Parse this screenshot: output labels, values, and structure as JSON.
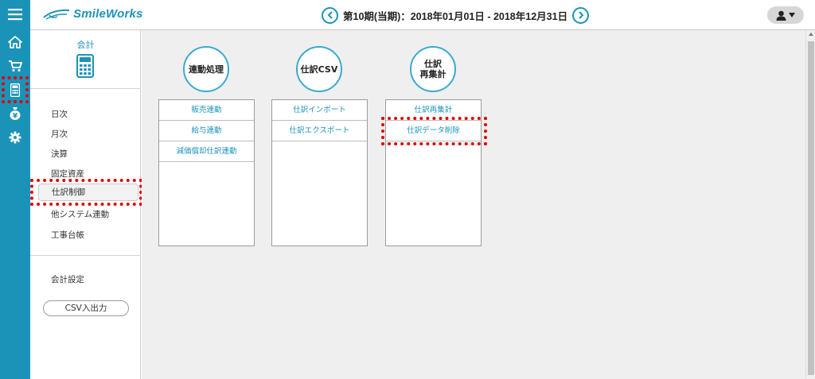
{
  "app": {
    "logo_text": "SmileWorks"
  },
  "header": {
    "period_text": "第10期(当期)：2018年01月01日 - 2018年12月31日",
    "prev_icon": "chevron-left-icon",
    "next_icon": "chevron-right-icon",
    "user_icon": "user-icon"
  },
  "rail": {
    "items": [
      {
        "icon": "hamburger-menu-icon"
      },
      {
        "icon": "home-icon"
      },
      {
        "icon": "cart-icon"
      },
      {
        "icon": "calculator-icon",
        "selected": true
      },
      {
        "icon": "yen-bag-icon"
      },
      {
        "icon": "gear-icon"
      }
    ]
  },
  "nav": {
    "title": "会計",
    "items": [
      "日次",
      "月次",
      "決算",
      "固定資産",
      "仕訳制御",
      "他システム連動",
      "工事台帳"
    ],
    "active_index": 4,
    "settings_label": "会計設定",
    "csv_button_label": "CSV入出力"
  },
  "columns": [
    {
      "title_line1": "連動処理",
      "title_line2": "",
      "items": [
        "販売連動",
        "給与連動",
        "減価償却仕訳連動"
      ]
    },
    {
      "title_line1": "仕訳CSV",
      "title_line2": "",
      "items": [
        "仕訳インポート",
        "仕訳エクスポート"
      ]
    },
    {
      "title_line1": "仕訳",
      "title_line2": "再集計",
      "items": [
        "仕訳再集計",
        "仕訳データ削除"
      ]
    }
  ],
  "highlight_color": "#e00000",
  "accent_color": "#1b93b8"
}
